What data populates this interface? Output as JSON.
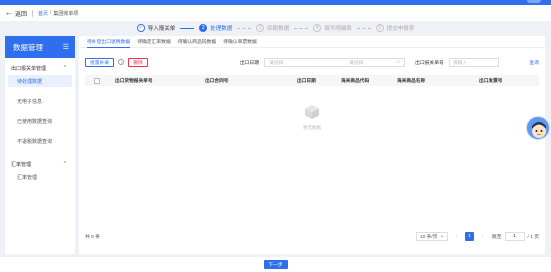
{
  "nav": {
    "back_label": "返回",
    "breadcrumb": [
      "首页",
      "/",
      "集团账单项"
    ]
  },
  "steps": [
    {
      "num": "✓",
      "label": "导入报关单",
      "state": "done"
    },
    {
      "num": "2",
      "label": "处理数据",
      "state": "active"
    },
    {
      "num": "3",
      "label": "匹配数据",
      "state": "todo"
    },
    {
      "num": "4",
      "label": "填写明细表",
      "state": "todo"
    },
    {
      "num": "5",
      "label": "提交申报表",
      "state": "todo"
    }
  ],
  "sidebar": {
    "title": "数据管理",
    "groups": [
      {
        "label": "出口报关单管理",
        "items": [
          "待处理数据",
          "无电子信息",
          "已使用数据查询",
          "不退税数据查询"
        ]
      },
      {
        "label": "汇率管理",
        "items": [
          "汇率管理"
        ]
      }
    ]
  },
  "tabs": [
    "待补登出口退税数据",
    "待确定汇率数据",
    "待确认商品码数据",
    "待确认单票数据"
  ],
  "toolbar": {
    "batch_label": "批量补录",
    "info_icon": "i",
    "delete_label": "删除",
    "date_label": "出口日期",
    "date_start_placeholder": "请选择",
    "date_sep": "-",
    "date_end_placeholder": "请选择",
    "decl_label": "出口报关单号",
    "decl_placeholder": "请输入",
    "query_label": "查询"
  },
  "table": {
    "columns": [
      "出口货物报关单号",
      "出口合同号",
      "出口日期",
      "海关商品代码",
      "海关商品名称",
      "出口发票号"
    ],
    "empty_text": "暂无数据"
  },
  "footer": {
    "total": "共 0 条",
    "page_size": "10 条/页",
    "prev": "‹",
    "current_page": "1",
    "next": "›",
    "goto_label": "跳至",
    "goto_value": "1",
    "total_pages": "/ 1 页"
  },
  "bottom": {
    "next_label": "下一步"
  },
  "colors": {
    "accent": "#2f6fed",
    "danger": "#ee3344"
  }
}
